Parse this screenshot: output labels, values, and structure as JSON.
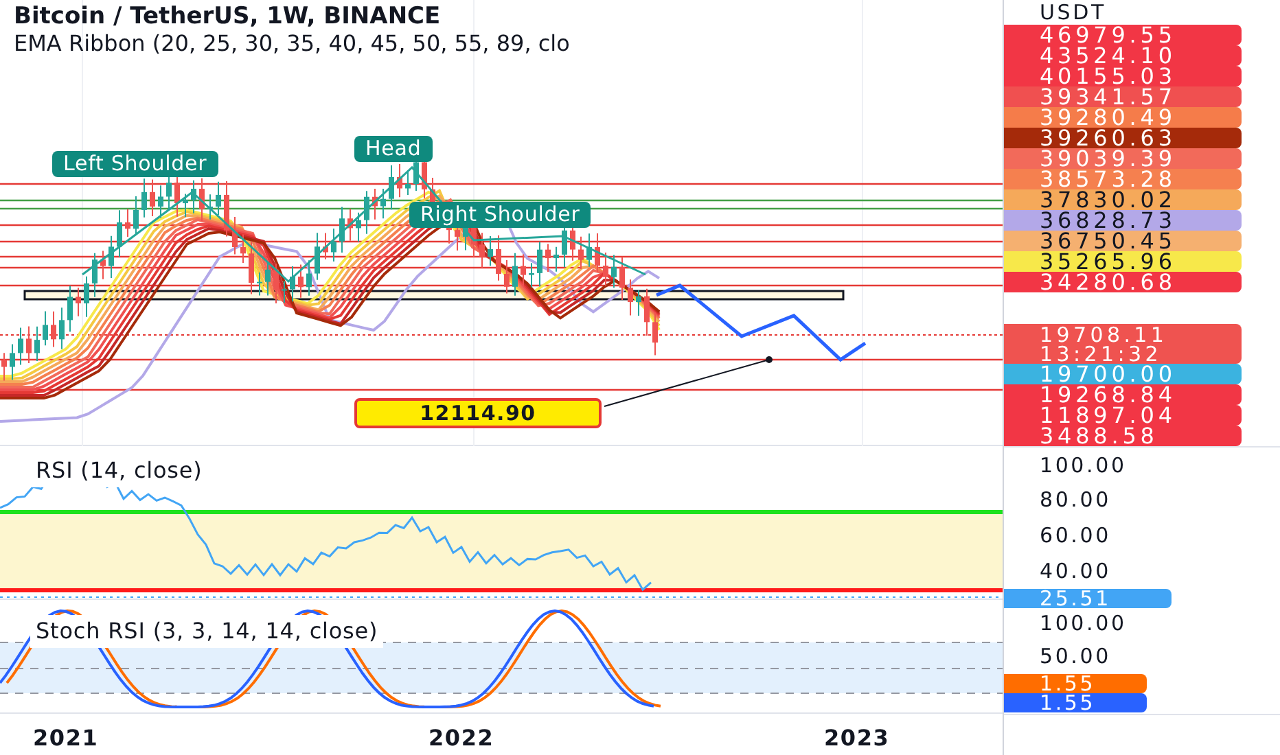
{
  "legend": {
    "title": "Bitcoin / TetherUS, 1W, BINANCE",
    "indicator": "EMA Ribbon (20, 25, 30, 35, 40, 45, 50, 55, 89, clo"
  },
  "annotations": [
    {
      "text": "Left Shoulder"
    },
    {
      "text": "Head"
    },
    {
      "text": "Right Shoulder"
    }
  ],
  "price_label": "12114.90",
  "price_axis": {
    "currency": "USDT",
    "tags": [
      {
        "text": "46979.55",
        "color": "#f23645"
      },
      {
        "text": "43524.10",
        "color": "#f23645"
      },
      {
        "text": "40155.03",
        "color": "#f23645"
      },
      {
        "text": "39341.57",
        "color": "#f05050"
      },
      {
        "text": "39280.49",
        "color": "#f57c4a"
      },
      {
        "text": "39260.63",
        "color": "#a52a0a"
      },
      {
        "text": "39039.39",
        "color": "#f26a5a"
      },
      {
        "text": "38573.28",
        "color": "#f5804f"
      },
      {
        "text": "37830.02",
        "color": "#f5a95a"
      },
      {
        "text": "36828.73",
        "color": "#b3a8e8"
      },
      {
        "text": "36750.45",
        "color": "#f5b070"
      },
      {
        "text": "35265.96",
        "color": "#f7e84a"
      },
      {
        "text": "34280.68",
        "color": "#f23645"
      }
    ],
    "last_price": {
      "text": "19708.11",
      "countdown": "13:21:32",
      "color": "#ef5350"
    },
    "lower_tags": [
      {
        "text": "19700.00",
        "color": "#3bb3e0"
      },
      {
        "text": "19268.84",
        "color": "#f23645"
      },
      {
        "text": "11897.04",
        "color": "#f23645"
      },
      {
        "text": "3488.58",
        "color": "#f23645"
      }
    ]
  },
  "rsi": {
    "title": "RSI (14, close)",
    "ticks": [
      "100.00",
      "80.00",
      "60.00",
      "40.00"
    ],
    "value": {
      "text": "25.51",
      "color": "#42a5f5"
    }
  },
  "stoch": {
    "title": "Stoch RSI (3, 3, 14, 14, close)",
    "ticks": [
      "100.00",
      "50.00"
    ],
    "values": [
      {
        "text": "1.55",
        "color": "#ff6d00"
      },
      {
        "text": "1.55",
        "color": "#2962ff"
      }
    ]
  },
  "time_axis": [
    "2021",
    "2022",
    "2023"
  ]
}
